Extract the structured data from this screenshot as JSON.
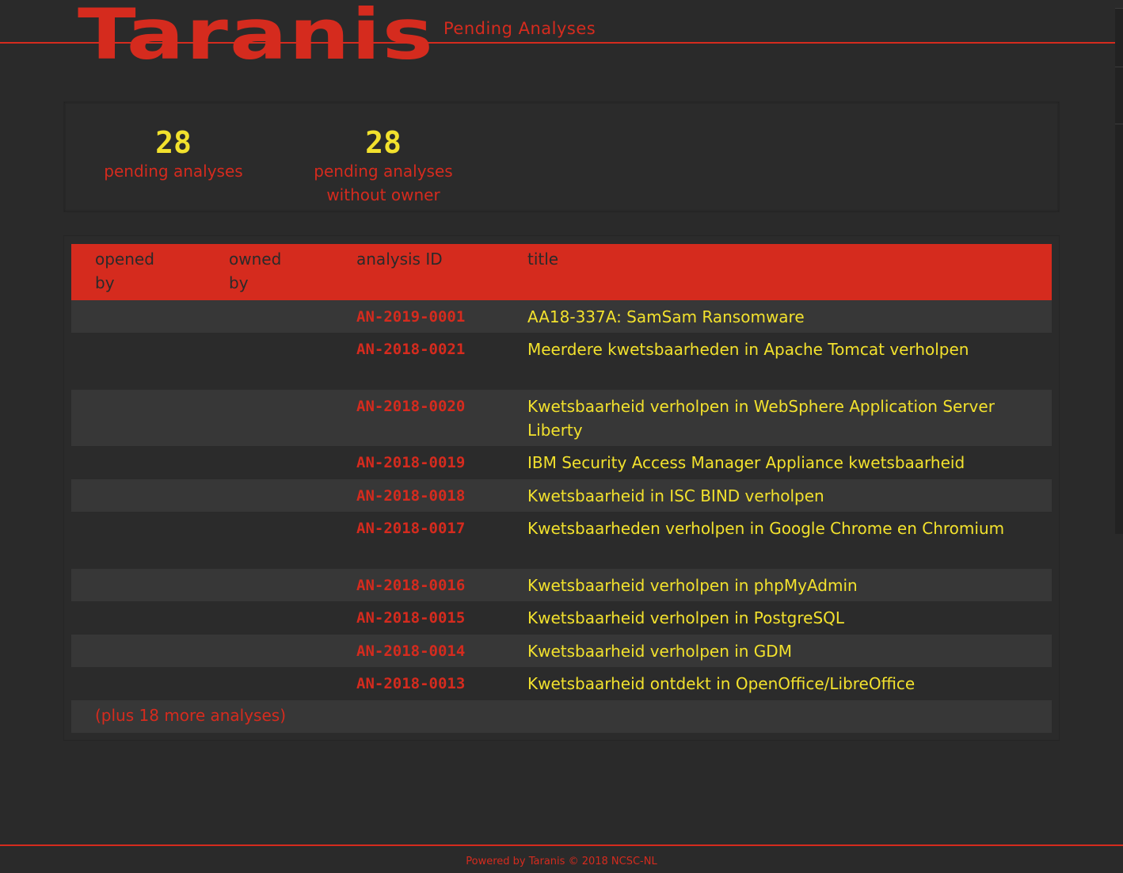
{
  "header": {
    "logo_text": "Taranis",
    "page_title": "Pending Analyses"
  },
  "summary": {
    "pending": {
      "value": "28",
      "label": "pending analyses"
    },
    "pending_no_owner": {
      "value": "28",
      "label_line1": "pending analyses",
      "label_line2": "without owner"
    }
  },
  "table": {
    "columns": {
      "opened_by_line1": "opened",
      "opened_by_line2": "by",
      "owned_by_line1": "owned",
      "owned_by_line2": "by",
      "analysis_id": "analysis ID",
      "title": "title"
    },
    "rows": [
      {
        "opened_by": "",
        "owned_by": "",
        "id": "AN-2019-0001",
        "title": "AA18-337A: SamSam Ransomware"
      },
      {
        "opened_by": "",
        "owned_by": "",
        "id": "AN-2018-0021",
        "title": "Meerdere kwetsbaarheden in Apache Tomcat verholpen"
      },
      {
        "opened_by": "",
        "owned_by": "",
        "id": "AN-2018-0020",
        "title": "Kwetsbaarheid verholpen in WebSphere Application Server Liberty"
      },
      {
        "opened_by": "",
        "owned_by": "",
        "id": "AN-2018-0019",
        "title": "IBM Security Access Manager Appliance kwetsbaarheid"
      },
      {
        "opened_by": "",
        "owned_by": "",
        "id": "AN-2018-0018",
        "title": "Kwetsbaarheid in ISC BIND verholpen"
      },
      {
        "opened_by": "",
        "owned_by": "",
        "id": "AN-2018-0017",
        "title": "Kwetsbaarheden verholpen in Google Chrome en Chromium"
      },
      {
        "opened_by": "",
        "owned_by": "",
        "id": "AN-2018-0016",
        "title": "Kwetsbaarheid verholpen in phpMyAdmin"
      },
      {
        "opened_by": "",
        "owned_by": "",
        "id": "AN-2018-0015",
        "title": "Kwetsbaarheid verholpen in PostgreSQL"
      },
      {
        "opened_by": "",
        "owned_by": "",
        "id": "AN-2018-0014",
        "title": "Kwetsbaarheid verholpen in GDM"
      },
      {
        "opened_by": "",
        "owned_by": "",
        "id": "AN-2018-0013",
        "title": "Kwetsbaarheid ontdekt in OpenOffice/LibreOffice"
      }
    ],
    "more_text": "(plus 18 more analyses)"
  },
  "footer": {
    "text": "Powered by Taranis © 2018 NCSC-NL"
  },
  "colors": {
    "accent": "#d52b1e",
    "highlight": "#f2e12d",
    "background": "#2a2a2a",
    "row_alt": "#373737"
  }
}
